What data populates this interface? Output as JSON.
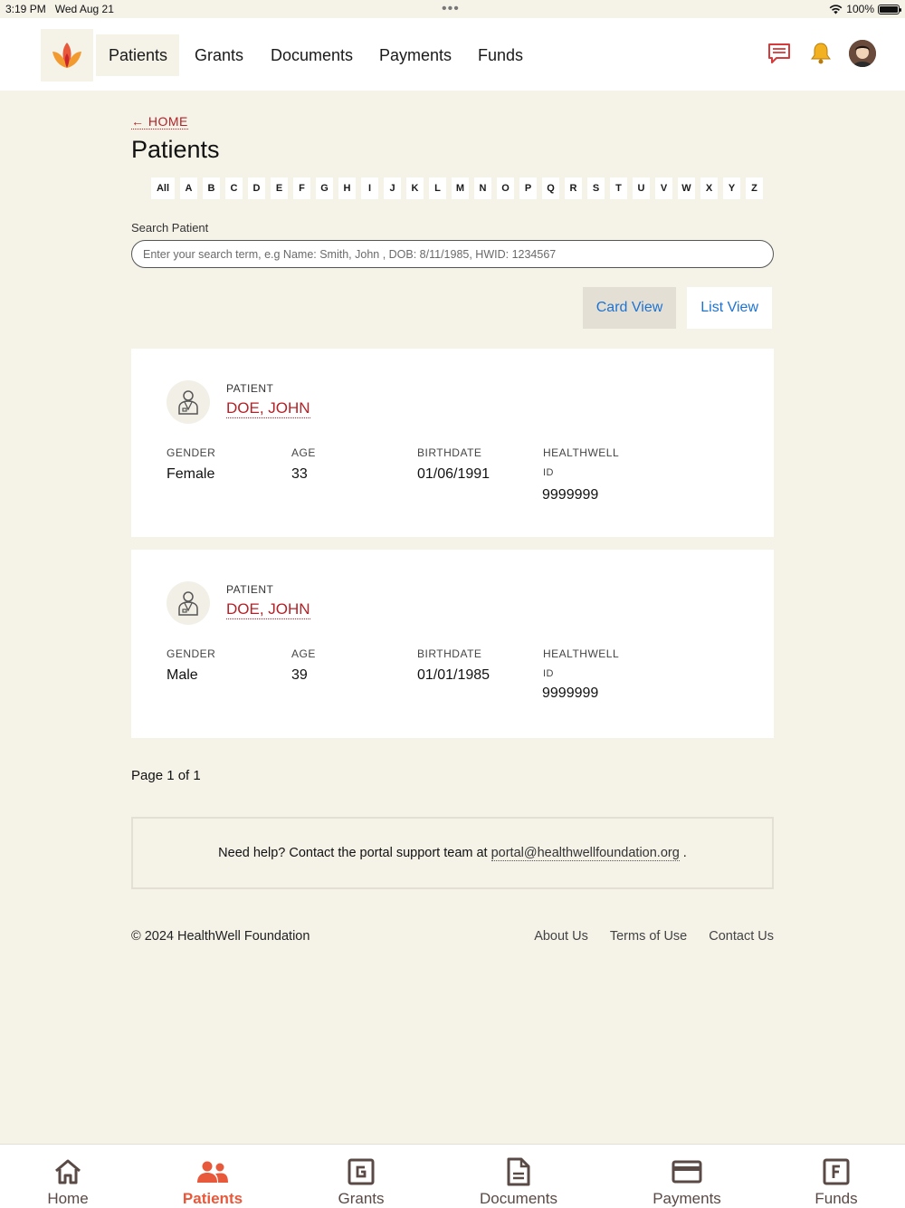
{
  "status_bar": {
    "time": "3:19 PM",
    "date": "Wed Aug 21",
    "battery": "100%"
  },
  "nav": {
    "items": [
      "Patients",
      "Grants",
      "Documents",
      "Payments",
      "Funds"
    ],
    "active": "Patients"
  },
  "breadcrumb": {
    "back_label": "← HOME"
  },
  "page": {
    "title": "Patients"
  },
  "alphabet": [
    "All",
    "A",
    "B",
    "C",
    "D",
    "E",
    "F",
    "G",
    "H",
    "I",
    "J",
    "K",
    "L",
    "M",
    "N",
    "O",
    "P",
    "Q",
    "R",
    "S",
    "T",
    "U",
    "V",
    "W",
    "X",
    "Y",
    "Z"
  ],
  "search": {
    "label": "Search Patient",
    "placeholder": "Enter your search term, e.g Name: Smith, John , DOB: 8/11/1985, HWID: 1234567",
    "value": ""
  },
  "view_toggle": {
    "card_label": "Card View",
    "list_label": "List View",
    "active": "Card View"
  },
  "field_labels": {
    "patient": "PATIENT",
    "gender": "GENDER",
    "age": "AGE",
    "birthdate": "BIRTHDATE",
    "healthwell": "HEALTHWELL",
    "id": "ID"
  },
  "patients": [
    {
      "name": "DOE, JOHN",
      "gender": "Female",
      "age": "33",
      "birthdate": "01/06/1991",
      "healthwell_id": "9999999"
    },
    {
      "name": "DOE, JOHN",
      "gender": "Male",
      "age": "39",
      "birthdate": "01/01/1985",
      "healthwell_id": "9999999"
    }
  ],
  "pagination": {
    "text": "Page 1 of 1"
  },
  "help": {
    "text": "Need help? Contact the portal support team at",
    "email": "portal@healthwellfoundation.org",
    "suffix": "."
  },
  "footer": {
    "copyright": "© 2024 HealthWell Foundation",
    "links": [
      "About Us",
      "Terms of Use",
      "Contact Us"
    ]
  },
  "tabbar": {
    "items": [
      "Home",
      "Patients",
      "Grants",
      "Documents",
      "Payments",
      "Funds"
    ],
    "active": "Patients"
  },
  "colors": {
    "accent": "#b52127",
    "brand_orange": "#e8583a",
    "link_blue": "#1e73d2",
    "background": "#f5f2e8"
  },
  "icons": {
    "logo": "flame-lotus-logo",
    "messages": "chat-bubble-icon",
    "notifications": "bell-icon",
    "profile": "avatar",
    "patient": "person-icon"
  }
}
